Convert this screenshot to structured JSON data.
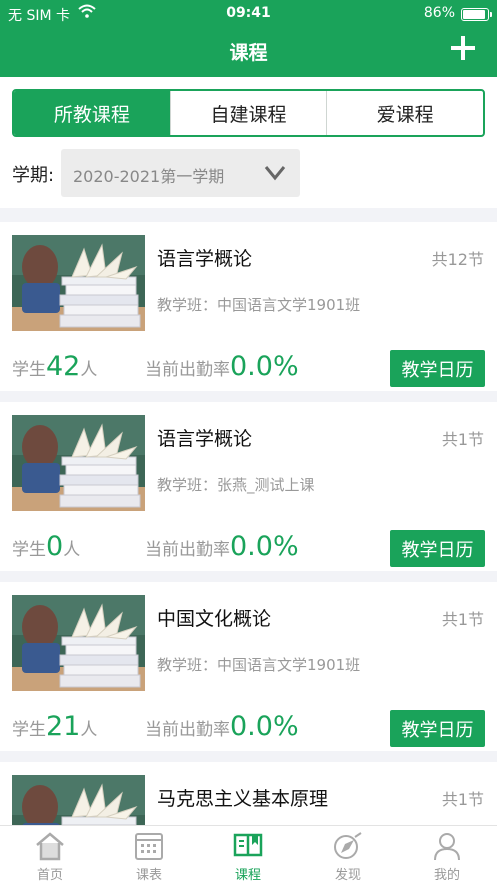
{
  "status_bar": {
    "carrier": "无 SIM 卡",
    "time": "09:41",
    "battery": "86%",
    "battery_level": 0.86
  },
  "header": {
    "title": "课程",
    "add_icon": "plus-icon"
  },
  "tabs": [
    {
      "label": "所教课程",
      "active": true
    },
    {
      "label": "自建课程",
      "active": false
    },
    {
      "label": "爱课程",
      "active": false
    }
  ],
  "term": {
    "label": "学期:",
    "value": "2020-2021第一学期",
    "icon": "chevron-down-icon"
  },
  "courses": [
    {
      "name": "语言学概论",
      "count": "共12节",
      "class": "教学班：中国语言文学1901班",
      "students_prefix": "学生",
      "students": "42",
      "students_suffix": "人",
      "rate_label": "当前出勤率",
      "rate": "0.0%",
      "button": "教学日历"
    },
    {
      "name": "语言学概论",
      "count": "共1节",
      "class": "教学班：张燕_测试上课",
      "students_prefix": "学生",
      "students": "0",
      "students_suffix": "人",
      "rate_label": "当前出勤率",
      "rate": "0.0%",
      "button": "教学日历"
    },
    {
      "name": "中国文化概论",
      "count": "共1节",
      "class": "教学班：中国语言文学1901班",
      "students_prefix": "学生",
      "students": "21",
      "students_suffix": "人",
      "rate_label": "当前出勤率",
      "rate": "0.0%",
      "button": "教学日历"
    },
    {
      "name": "马克思主义基本原理",
      "count": "共1节"
    }
  ],
  "tabbar": [
    {
      "label": "首页",
      "icon": "home-icon",
      "active": false
    },
    {
      "label": "课表",
      "icon": "calendar-icon",
      "active": false
    },
    {
      "label": "课程",
      "icon": "book-icon",
      "active": true
    },
    {
      "label": "发现",
      "icon": "compass-icon",
      "active": false
    },
    {
      "label": "我的",
      "icon": "person-icon",
      "active": false
    }
  ],
  "colors": {
    "accent": "#1aa35a",
    "muted": "#999999",
    "separator": "#f2f3f7"
  }
}
